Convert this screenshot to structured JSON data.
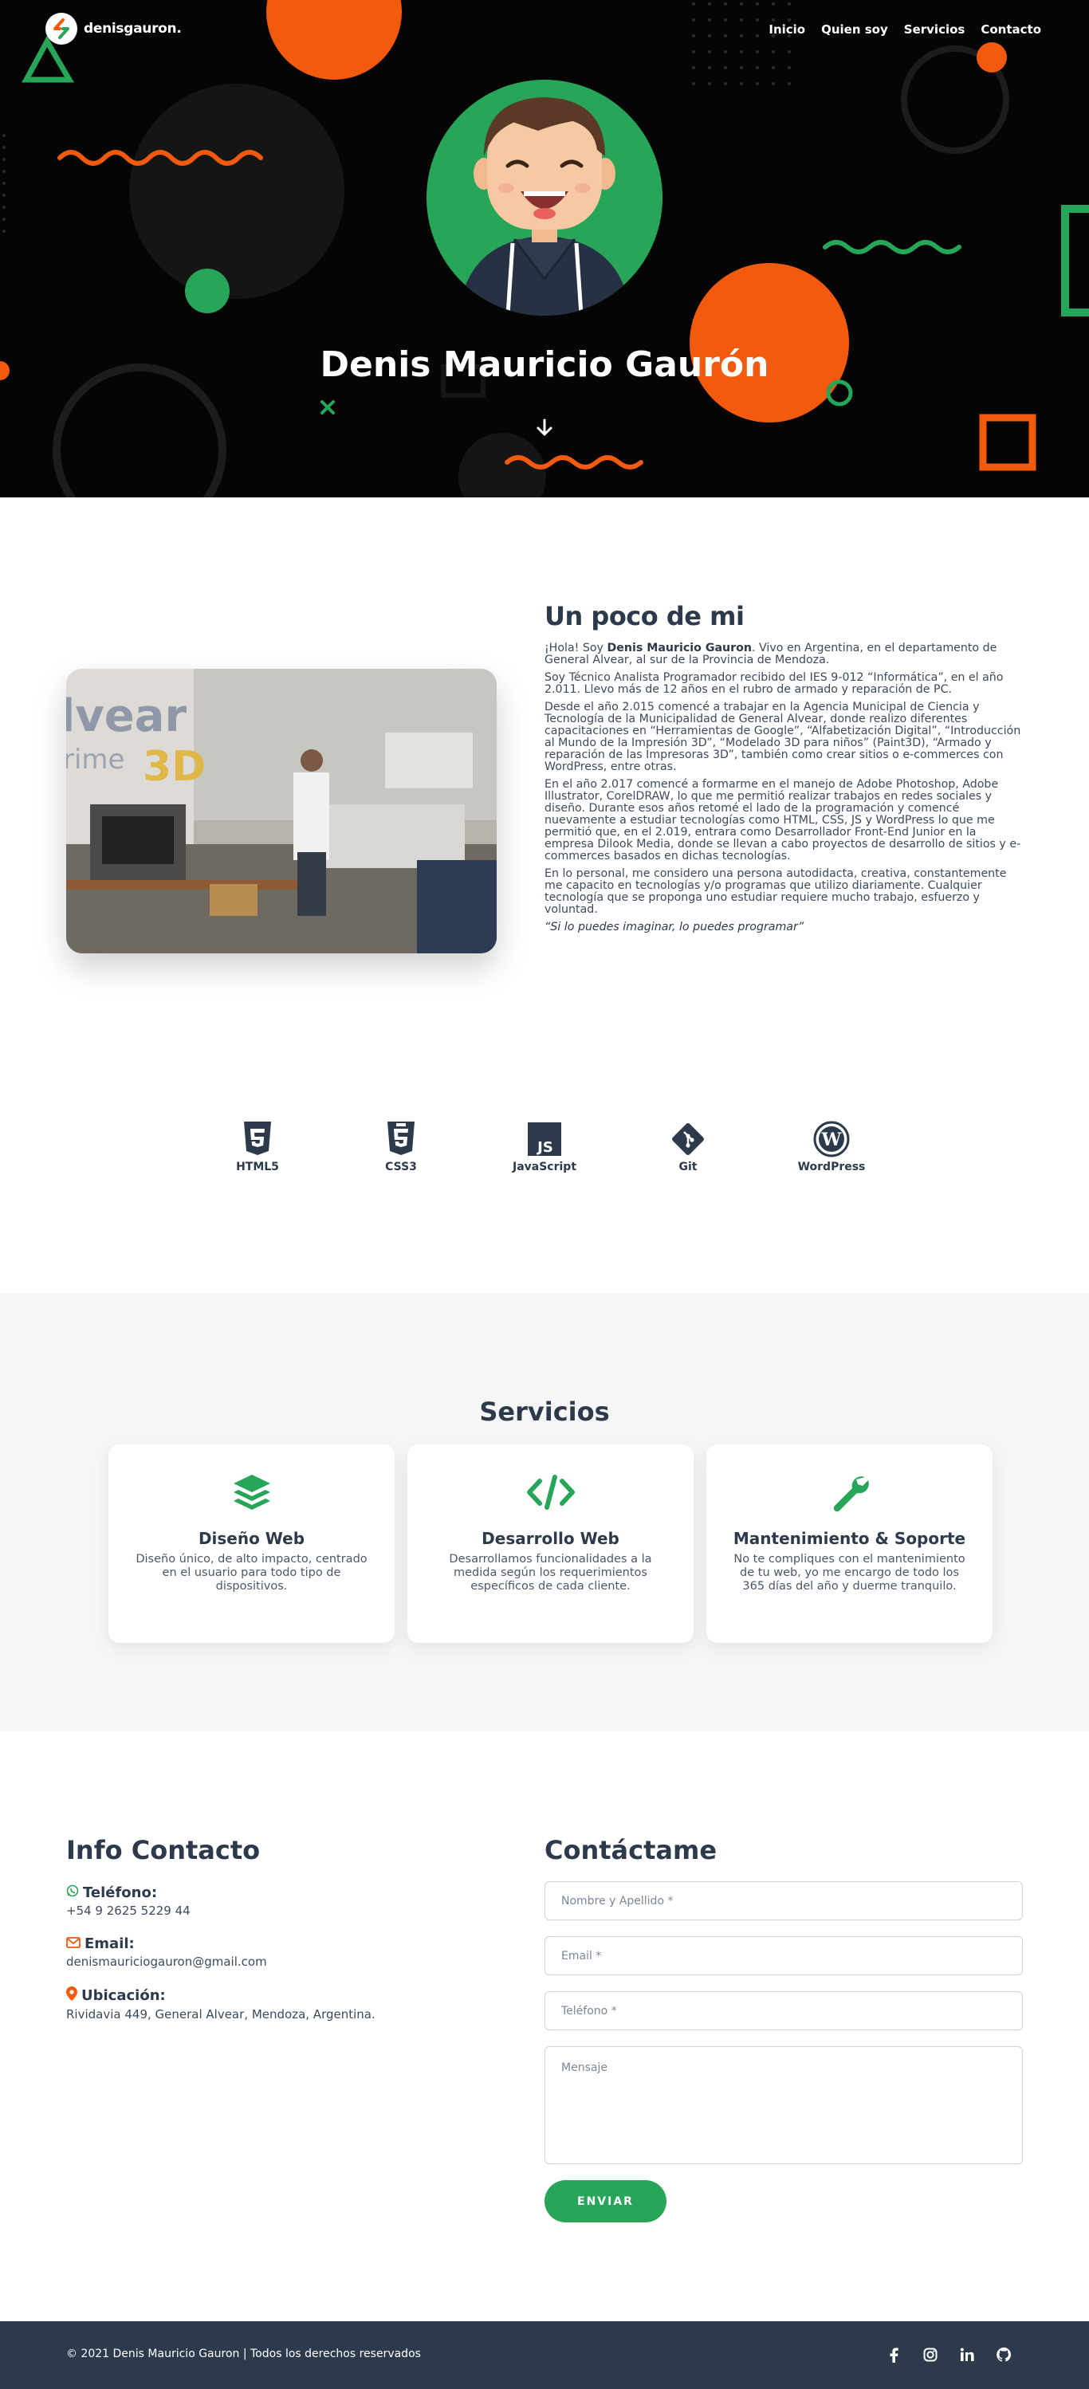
{
  "nav": {
    "logo_text": "denisgauron.",
    "items": [
      {
        "label": "Inicio"
      },
      {
        "label": "Quien soy"
      },
      {
        "label": "Servicios"
      },
      {
        "label": "Contacto"
      }
    ]
  },
  "hero": {
    "title": "Denis Mauricio Gaurón",
    "scroll_icon": "arrow-down-icon"
  },
  "about": {
    "title": "Un poco de mi",
    "p1_pre": "¡Hola! Soy ",
    "p1_name": "Denis Mauricio Gauron",
    "p1_post": ". Vivo en Argentina, en el departamento de General Alvear, al sur de la Provincia de Mendoza.",
    "p2": "Soy Técnico Analista Programador recibido del IES 9-012 “Informática”, en el año 2.011. Llevo más de 12 años en el rubro de armado y reparación de PC.",
    "p3": "Desde el año 2.015 comencé a trabajar en la Agencia Municipal de Ciencia y Tecnología de la Municipalidad de General Alvear, donde realizo diferentes capacitaciones en “Herramientas de Google”, “Alfabetización Digital”, “Introducción al Mundo de la Impresión 3D”, “Modelado 3D para niños” (Paint3D), “Armado y reparación de las Impresoras 3D”, también como crear sitios o e-commerces con WordPress, entre otras.",
    "p4": "En el año 2.017 comencé a formarme en el manejo de Adobe Photoshop, Adobe Illustrator, CorelDRAW, lo que me permitió realizar trabajos en redes sociales y diseño. Durante esos años retomé el lado de la programación y comencé nuevamente a estudiar tecnologías como HTML, CSS, JS y WordPress lo que me permitió que, en el 2.019, entrara como Desarrollador Front-End Junior en la empresa Dilook Media, donde se llevan a cabo proyectos de desarrollo de sitios y e-commerces basados en dichas tecnologías.",
    "p5": "En lo personal, me considero una persona autodidacta, creativa, constantemente me capacito en tecnologías y/o programas que utilizo diariamente. Cualquier tecnología que se proponga uno estudiar requiere mucho trabajo, esfuerzo y voluntad.",
    "quote": "“Si lo puedes imaginar, lo puedes programar”",
    "photo_text_big": "lvear",
    "photo_text_small": "rime",
    "photo_text_3d": "3D"
  },
  "skills": [
    {
      "label": "HTML5",
      "icon": "html5-icon"
    },
    {
      "label": "CSS3",
      "icon": "css3-icon"
    },
    {
      "label": "JavaScript",
      "icon": "javascript-icon"
    },
    {
      "label": "Git",
      "icon": "git-icon"
    },
    {
      "label": "WordPress",
      "icon": "wordpress-icon"
    }
  ],
  "services": {
    "title": "Servicios",
    "items": [
      {
        "title": "Diseño Web",
        "desc": "Diseño único, de alto impacto, centrado en el usuario para todo tipo de dispositivos.",
        "icon": "layers-icon"
      },
      {
        "title": "Desarrollo Web",
        "desc": "Desarrollamos funcionalidades a la medida según los requerimientos específicos de cada cliente.",
        "icon": "code-icon"
      },
      {
        "title": "Mantenimiento & Soporte",
        "desc": "No te compliques con el mantenimiento de tu web, yo me encargo de todo los 365 días del año y duerme tranquilo.",
        "icon": "wrench-icon"
      }
    ]
  },
  "contact_info": {
    "title": "Info Contacto",
    "phone_label": "Teléfono:",
    "phone": "+54 9 2625 5229 44",
    "email_label": "Email:",
    "email": "denismauriciogauron@gmail.com",
    "location_label": "Ubicación:",
    "location": "Rividavia 449, General Alvear, Mendoza, Argentina."
  },
  "contact_form": {
    "title": "Contáctame",
    "name_placeholder": "Nombre y Apellido *",
    "email_placeholder": "Email *",
    "phone_placeholder": "Teléfono *",
    "message_placeholder": "Mensaje",
    "send_label": "ENVIAR"
  },
  "footer": {
    "copyright": "© 2021 Denis Mauricio Gauron | Todos los derechos reservados",
    "socials": [
      "facebook-icon",
      "instagram-icon",
      "linkedin-icon",
      "github-icon"
    ]
  },
  "colors": {
    "accent_green": "#27a559",
    "accent_orange": "#f25a0d",
    "dark": "#050505",
    "navy": "#2d3a4b"
  }
}
